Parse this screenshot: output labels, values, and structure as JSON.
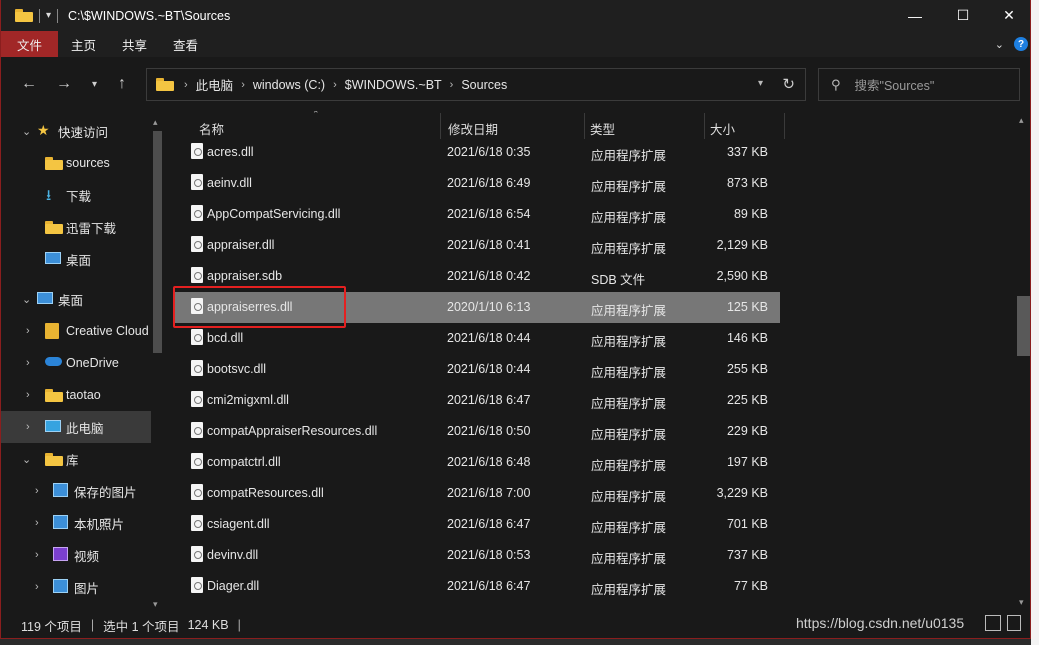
{
  "titlebar": {
    "path": "C:\\$WINDOWS.~BT\\Sources",
    "minimize": "—",
    "maximize": "☐",
    "close": "✕"
  },
  "ribbon": {
    "tabs": [
      "文件",
      "主页",
      "共享",
      "查看"
    ]
  },
  "address": {
    "crumbs": [
      "此电脑",
      "windows (C:)",
      "$WINDOWS.~BT",
      "Sources"
    ],
    "search_placeholder": "搜索\"Sources\""
  },
  "nav": {
    "items": [
      {
        "label": "快速访问",
        "icon": "star-icon"
      },
      {
        "label": "sources",
        "icon": "folder-icon"
      },
      {
        "label": "下载",
        "icon": "download-icon"
      },
      {
        "label": "迅雷下载",
        "icon": "folder-icon"
      },
      {
        "label": "桌面",
        "icon": "desktop-icon"
      },
      {
        "label": "桌面",
        "icon": "desktop-icon"
      },
      {
        "label": "Creative Cloud Files",
        "icon": "creative-cloud-icon"
      },
      {
        "label": "OneDrive",
        "icon": "onedrive-icon"
      },
      {
        "label": "taotao",
        "icon": "folder-icon"
      },
      {
        "label": "此电脑",
        "icon": "computer-icon"
      },
      {
        "label": "库",
        "icon": "library-icon"
      },
      {
        "label": "保存的图片",
        "icon": "pictures-icon"
      },
      {
        "label": "本机照片",
        "icon": "pictures-icon"
      },
      {
        "label": "视频",
        "icon": "video-icon"
      },
      {
        "label": "图片",
        "icon": "pictures-icon"
      }
    ]
  },
  "columns": {
    "name": "名称",
    "date": "修改日期",
    "type": "类型",
    "size": "大小"
  },
  "files": [
    {
      "name": "acres.dll",
      "date": "2021/6/18 0:35",
      "type": "应用程序扩展",
      "size": "337 KB"
    },
    {
      "name": "aeinv.dll",
      "date": "2021/6/18 6:49",
      "type": "应用程序扩展",
      "size": "873 KB"
    },
    {
      "name": "AppCompatServicing.dll",
      "date": "2021/6/18 6:54",
      "type": "应用程序扩展",
      "size": "89 KB"
    },
    {
      "name": "appraiser.dll",
      "date": "2021/6/18 0:41",
      "type": "应用程序扩展",
      "size": "2,129 KB"
    },
    {
      "name": "appraiser.sdb",
      "date": "2021/6/18 0:42",
      "type": "SDB 文件",
      "size": "2,590 KB"
    },
    {
      "name": "appraiserres.dll",
      "date": "2020/1/10 6:13",
      "type": "应用程序扩展",
      "size": "125 KB",
      "selected": true
    },
    {
      "name": "bcd.dll",
      "date": "2021/6/18 0:44",
      "type": "应用程序扩展",
      "size": "146 KB"
    },
    {
      "name": "bootsvc.dll",
      "date": "2021/6/18 0:44",
      "type": "应用程序扩展",
      "size": "255 KB"
    },
    {
      "name": "cmi2migxml.dll",
      "date": "2021/6/18 6:47",
      "type": "应用程序扩展",
      "size": "225 KB"
    },
    {
      "name": "compatAppraiserResources.dll",
      "date": "2021/6/18 0:50",
      "type": "应用程序扩展",
      "size": "229 KB"
    },
    {
      "name": "compatctrl.dll",
      "date": "2021/6/18 6:48",
      "type": "应用程序扩展",
      "size": "197 KB"
    },
    {
      "name": "compatResources.dll",
      "date": "2021/6/18 7:00",
      "type": "应用程序扩展",
      "size": "3,229 KB"
    },
    {
      "name": "csiagent.dll",
      "date": "2021/6/18 6:47",
      "type": "应用程序扩展",
      "size": "701 KB"
    },
    {
      "name": "devinv.dll",
      "date": "2021/6/18 0:53",
      "type": "应用程序扩展",
      "size": "737 KB"
    },
    {
      "name": "Diager.dll",
      "date": "2021/6/18 6:47",
      "type": "应用程序扩展",
      "size": "77 KB"
    }
  ],
  "status": {
    "count": "119 个项目",
    "selected": "选中 1 个项目",
    "selected_size": "124 KB"
  },
  "watermark": "https://blog.csdn.net/u0135",
  "colors": {
    "accent": "#a12727",
    "selection": "#777777",
    "highlight": "#e42020"
  }
}
